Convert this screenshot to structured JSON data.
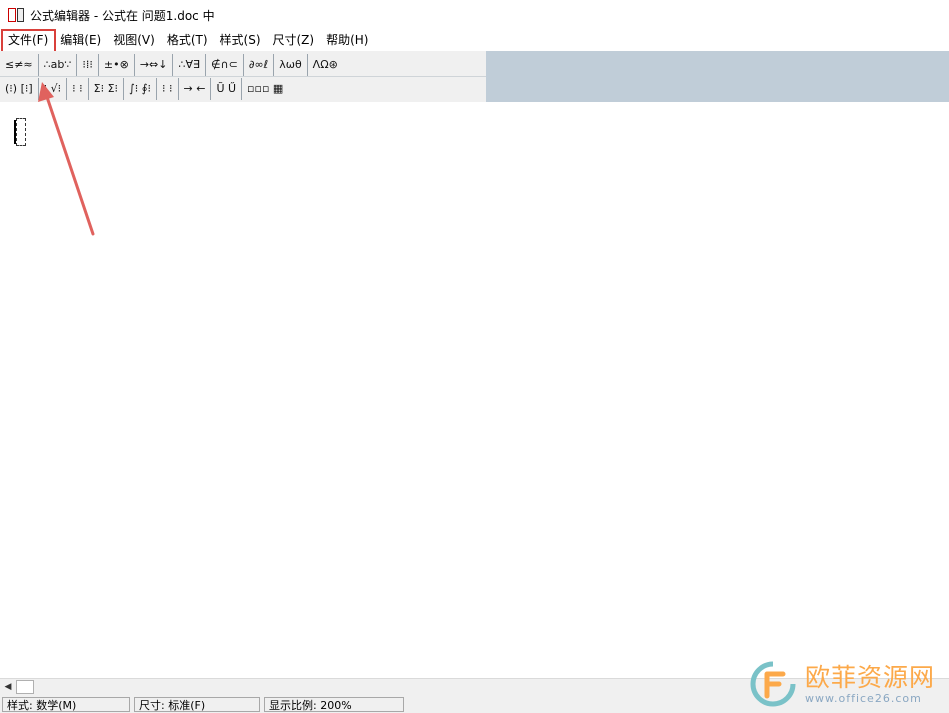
{
  "window": {
    "title": "公式编辑器 - 公式在 问题1.doc 中"
  },
  "menu": {
    "items": [
      "文件(F)",
      "编辑(E)",
      "视图(V)",
      "格式(T)",
      "样式(S)",
      "尺寸(Z)",
      "帮助(H)"
    ]
  },
  "palette": {
    "row1": [
      "≤≠≈",
      "∴ab∵",
      "⁝⁞⁝",
      "±•⊗",
      "→⇔↓",
      "∴∀∃",
      "∉∩⊂",
      "∂∞ℓ",
      "λωθ",
      "ΛΩ⊛"
    ],
    "row2": [
      "(⁝) [⁝]",
      "⁝ √⁝",
      "⁝ ⁝",
      "Σ⁝ Σ⁝",
      "∫⁝ ∮⁝",
      "⁝ ⁝",
      "→ ←",
      "Ũ Ű",
      "▫▫▫ ▦"
    ]
  },
  "scrollbar": {
    "left_arrow": "◀"
  },
  "status": {
    "style": "样式: 数学(M)",
    "size": "尺寸: 标准(F)",
    "zoom": "显示比例: 200%"
  },
  "watermark": {
    "cn": "欧菲资源网",
    "en": "www.office26.com"
  },
  "colors": {
    "highlight": "#d9403b",
    "arrow": "#e0625e",
    "toolbar_bg": "#c0cdd8",
    "watermark_orange": "#fca94a",
    "watermark_blue": "#8aa7c2"
  }
}
